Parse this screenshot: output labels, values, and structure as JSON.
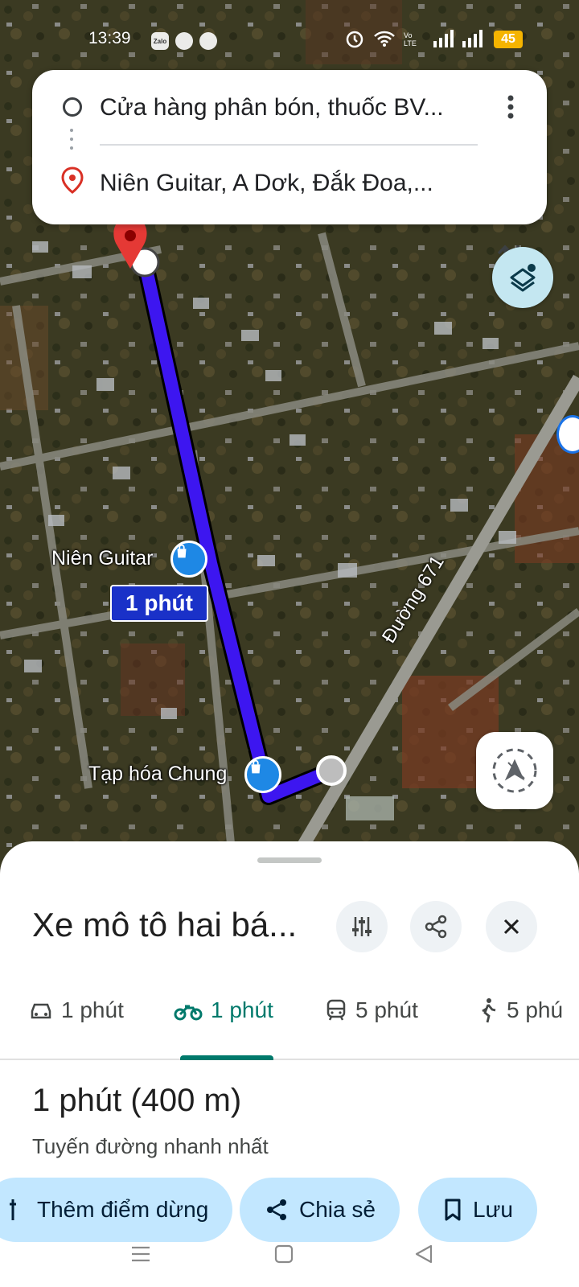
{
  "status_bar": {
    "time": "13:39",
    "battery": "45"
  },
  "route": {
    "origin": "Cửa hàng phân bón, thuốc BV...",
    "destination": "Niên Guitar, A Dơk, Đắk Đoa,..."
  },
  "map": {
    "poi_niien_guitar": "Niên Guitar",
    "poi_tap_hoa": "Tạp hóa Chung",
    "duration_tag": "1 phút",
    "road_name": "Đường 671"
  },
  "sheet": {
    "title": "Xe mô tô hai bá...",
    "tabs": [
      {
        "label": "1 phút",
        "icon": "car-icon"
      },
      {
        "label": "1 phút",
        "icon": "motorbike-icon"
      },
      {
        "label": "5 phút",
        "icon": "transit-icon"
      },
      {
        "label": "5 phú",
        "icon": "walk-icon"
      }
    ],
    "duration": "1 phút (400 m)",
    "description": "Tuyến đường nhanh nhất",
    "chips": {
      "add_stop": "Thêm điểm dừng",
      "share": "Chia sẻ",
      "save": "Lưu"
    }
  },
  "colors": {
    "route": "#3d16f0",
    "accent": "#00796b",
    "chip": "#c2e7ff"
  }
}
